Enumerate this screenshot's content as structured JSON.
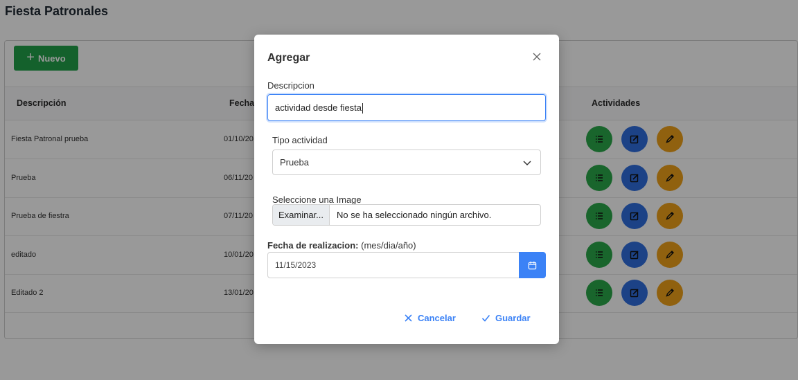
{
  "page": {
    "title": "Fiesta Patronales"
  },
  "toolbar": {
    "new_label": "Nuevo"
  },
  "table": {
    "headers": {
      "description": "Descripción",
      "date": "Fecha",
      "activities": "Actividades"
    },
    "rows": [
      {
        "description": "Fiesta Patronal prueba",
        "date": "01/10/20"
      },
      {
        "description": "Prueba",
        "date": "06/11/20"
      },
      {
        "description": "Prueba de fiestra",
        "date": "07/11/20"
      },
      {
        "description": "editado",
        "date": "10/01/20"
      },
      {
        "description": "Editado 2",
        "date": "13/01/20"
      }
    ]
  },
  "modal": {
    "title": "Agregar",
    "description": {
      "label": "Descripcion",
      "value": "actividad desde fiesta"
    },
    "activity_type": {
      "label": "Tipo actividad",
      "selected": "Prueba"
    },
    "image": {
      "label": "Seleccione una Image",
      "browse_label": "Examinar...",
      "status": "No se ha seleccionado ningún archivo."
    },
    "date": {
      "label": "Fecha de realizacion:",
      "format_hint": "(mes/dia/año)",
      "value": "11/15/2023"
    },
    "cancel_label": "Cancelar",
    "save_label": "Guardar"
  },
  "colors": {
    "primary": "#3b82f6",
    "success": "#2aa84a",
    "edit": "#2f6fe0",
    "warning": "#f0a21a"
  },
  "icons": {
    "new": "plus-icon",
    "row_actions": [
      "list-icon",
      "edit-square-icon",
      "pencil-icon"
    ],
    "close": "close-icon",
    "select": "chevron-down-icon",
    "date": "calendar-icon",
    "cancel": "x-icon",
    "save": "check-icon"
  }
}
